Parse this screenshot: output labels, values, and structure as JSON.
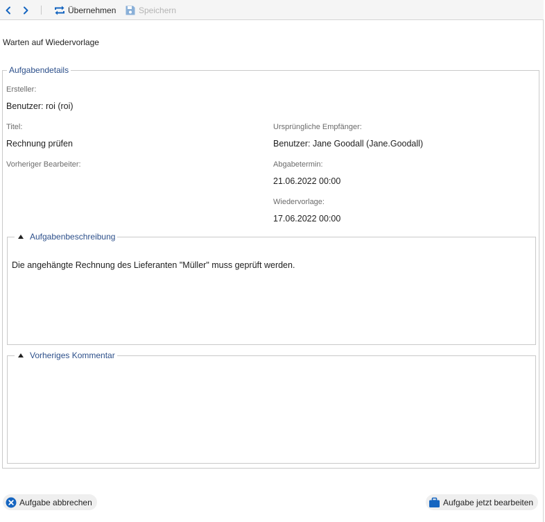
{
  "toolbar": {
    "prev_icon": "chevron-left-icon",
    "next_icon": "chevron-right-icon",
    "accept_label": "Übernehmen",
    "accept_icon": "repeat-arrows-icon",
    "save_label": "Speichern",
    "save_icon": "floppy-disk-icon"
  },
  "status": "Warten auf Wiedervorlage",
  "details": {
    "legend": "Aufgabendetails",
    "creator_label": "Ersteller:",
    "creator_value": "Benutzer: roi (roi)",
    "title_label": "Titel:",
    "title_value": "Rechnung prüfen",
    "recipients_label": "Ursprüngliche Empfänger:",
    "recipients_value": "Benutzer: Jane Goodall (Jane.Goodall)",
    "previous_editor_label": "Vorheriger Bearbeiter:",
    "due_label": "Abgabetermin:",
    "due_value": "21.06.2022 00:00",
    "resubmission_label": "Wiedervorlage:",
    "resubmission_value": "17.06.2022 00:00"
  },
  "description": {
    "legend": "Aufgabenbeschreibung",
    "text": "Die angehängte Rechnung des Lieferanten \"Müller\" muss geprüft werden."
  },
  "comment": {
    "legend": "Vorheriges Kommentar"
  },
  "footer": {
    "cancel_label": "Aufgabe abbrechen",
    "cancel_icon": "close-circle-icon",
    "edit_label": "Aufgabe jetzt bearbeiten",
    "edit_icon": "briefcase-icon"
  },
  "colors": {
    "accent": "#1565c0",
    "legend_text": "#2c4f8a",
    "disabled": "#b4b4b4"
  }
}
